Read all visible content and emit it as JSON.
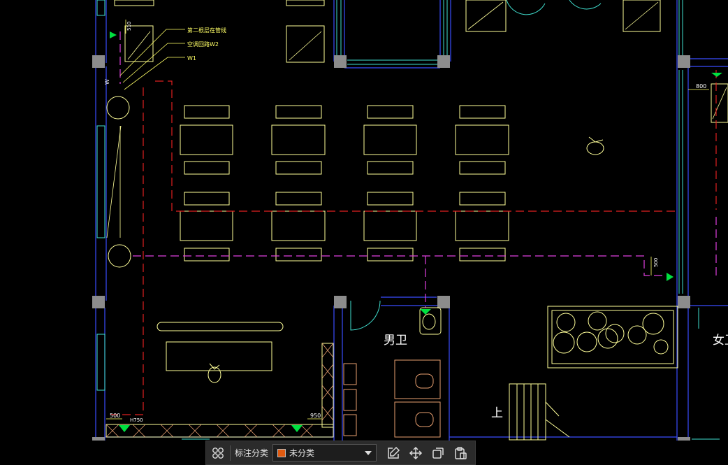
{
  "drawing": {
    "labels": {
      "ann1": "第二根层在管线",
      "ann2": "空调回路W2",
      "ann3": "W1",
      "dim_top": "510",
      "dim_right": "800",
      "dim_mid": "500",
      "dim_b1": "500",
      "dim_b2": "H750",
      "dim_b3": "950",
      "room_men": "男卫",
      "room_women": "女卫",
      "stair": "上",
      "tag_w": "W"
    }
  },
  "toolbar": {
    "category_label": "标注分类",
    "selected_category": "未分类",
    "selected_color": "#e05a10",
    "icons": [
      "grid-icon",
      "edit-icon",
      "move-icon",
      "copy-icon",
      "paste-icon"
    ]
  }
}
